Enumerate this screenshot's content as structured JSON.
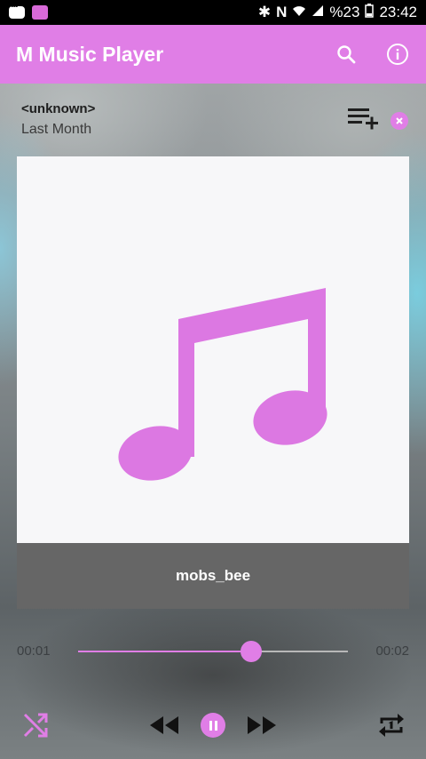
{
  "status_bar": {
    "icons": [
      "message-icon",
      "music-notification-icon",
      "bluetooth-icon",
      "nfc-icon",
      "wifi-icon",
      "signal-icon",
      "battery-icon"
    ],
    "battery": "%23",
    "time": "23:42"
  },
  "app": {
    "title": "M Music Player",
    "accent_color": "#e07ee6"
  },
  "now_playing": {
    "artist": "<unknown>",
    "album": "Last Month",
    "song_title": "mobs_bee",
    "current_time": "00:01",
    "total_time": "00:02",
    "progress": 0.64,
    "is_playing": true
  },
  "icons": {
    "search": "search-icon",
    "info": "info-icon",
    "add_to_playlist": "playlist-add-icon",
    "close": "close-icon",
    "album_art": "music-note-icon",
    "shuffle": "shuffle-icon",
    "previous": "rewind-icon",
    "pause": "pause-icon",
    "next": "fast-forward-icon",
    "repeat": "repeat-one-icon"
  }
}
